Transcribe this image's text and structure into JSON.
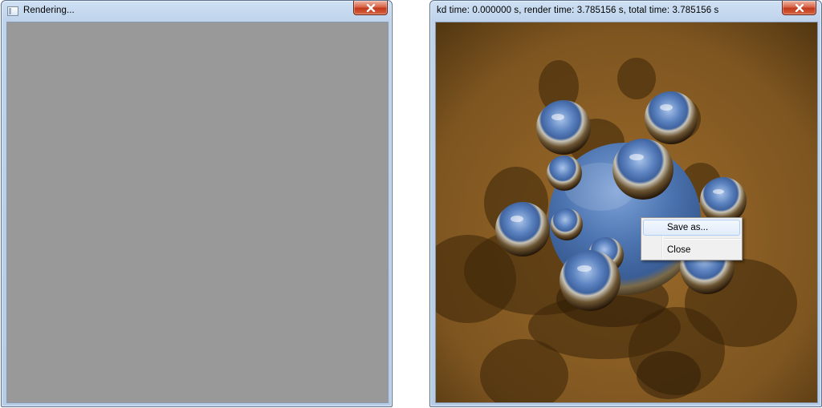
{
  "left_window": {
    "title": "Rendering...",
    "close_label": "Close",
    "canvas_color": "#999999"
  },
  "right_window": {
    "title": "kd time: 0.000000 s, render time: 3.785156 s, total time: 3.785156 s",
    "close_label": "Close",
    "scene": {
      "floor_color": "#8a5e22",
      "sphere_blue": "#5a7fb8",
      "shadow_color": "#3a2508"
    }
  },
  "context_menu": {
    "items": [
      {
        "label": "Save as...",
        "highlighted": true
      },
      {
        "label": "Close",
        "highlighted": false
      }
    ]
  }
}
